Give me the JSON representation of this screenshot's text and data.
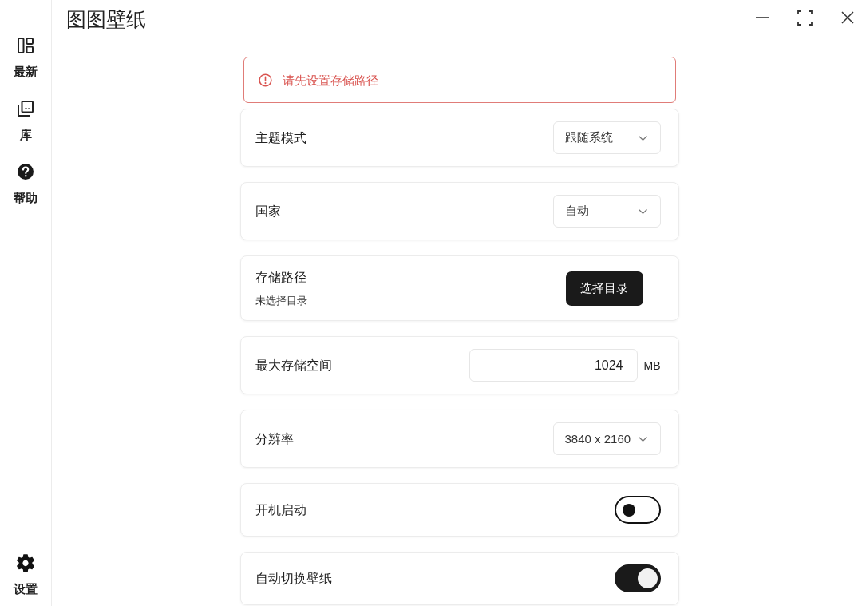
{
  "app": {
    "title": "图图壁纸"
  },
  "sidebar": {
    "items": [
      {
        "label": "最新"
      },
      {
        "label": "库"
      },
      {
        "label": "帮助"
      }
    ],
    "bottom_items": [
      {
        "label": "设置"
      }
    ]
  },
  "alert": {
    "message": "请先设置存储路径"
  },
  "settings": [
    {
      "kind": "select",
      "label": "主题模式",
      "value": "跟随系统"
    },
    {
      "kind": "select",
      "label": "国家",
      "value": "自动"
    },
    {
      "kind": "path",
      "label": "存储路径",
      "description": "未选择目录",
      "button": "选择目录"
    },
    {
      "kind": "number",
      "label": "最大存储空间",
      "value": "1024",
      "unit": "MB"
    },
    {
      "kind": "select",
      "label": "分辨率",
      "value": "3840 x 2160"
    },
    {
      "kind": "toggle",
      "label": "开机启动",
      "on": false
    },
    {
      "kind": "toggle",
      "label": "自动切换壁纸",
      "on": true
    }
  ]
}
